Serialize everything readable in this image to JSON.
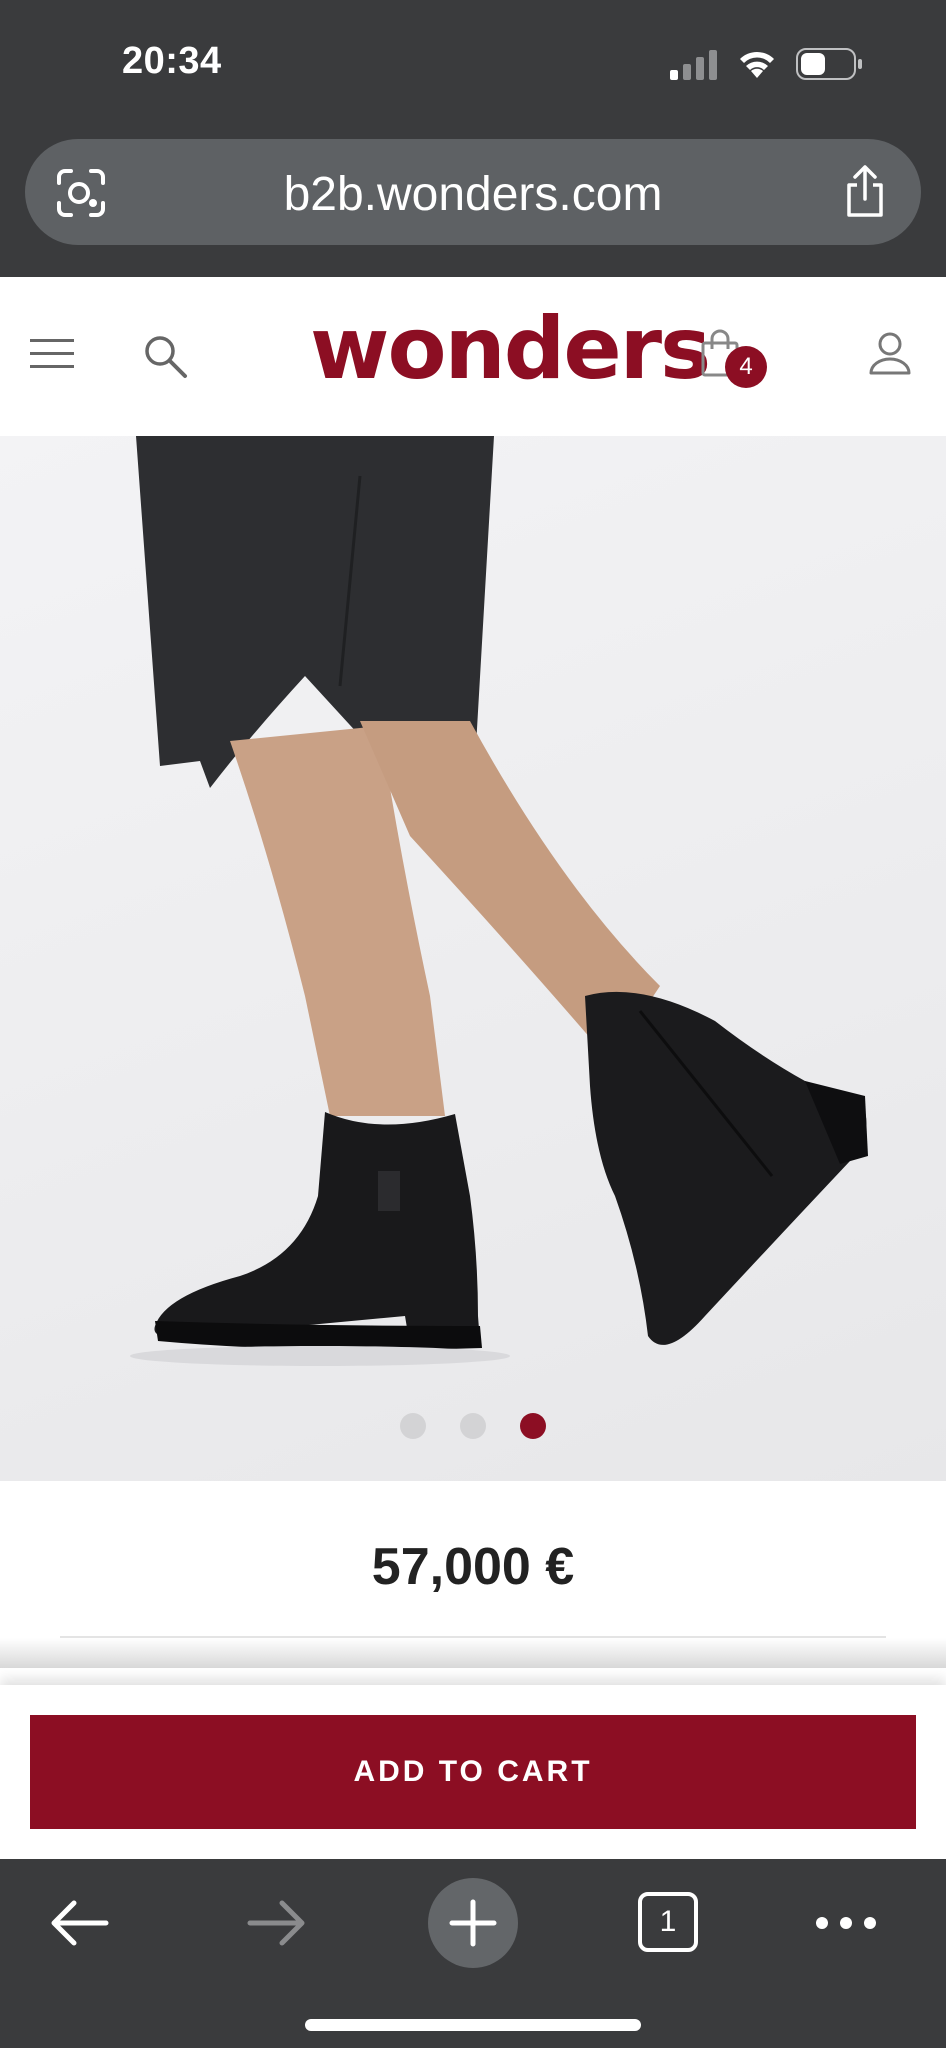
{
  "status_bar": {
    "time": "20:34",
    "icons": [
      "signal-icon",
      "wifi-icon",
      "battery-icon"
    ]
  },
  "browser": {
    "url": "b2b.wonders.com",
    "icons": [
      "lens-icon",
      "share-icon"
    ]
  },
  "header": {
    "logo": "wonders",
    "cart_count": "4",
    "icons": [
      "menu-icon",
      "search-icon",
      "bag-icon",
      "user-icon"
    ]
  },
  "product": {
    "price": "57,000 €",
    "gallery_total": 3,
    "gallery_active_index": 3
  },
  "actions": {
    "add_to_cart": "ADD TO CART"
  },
  "toolbar": {
    "tab_count": "1",
    "icons": [
      "back-arrow-icon",
      "forward-arrow-icon",
      "new-tab-plus-icon",
      "tabs-icon",
      "more-icon"
    ]
  },
  "colors": {
    "brand": "#8c0e23",
    "chrome": "#3a3b3d",
    "url_bar": "#5e6164"
  }
}
